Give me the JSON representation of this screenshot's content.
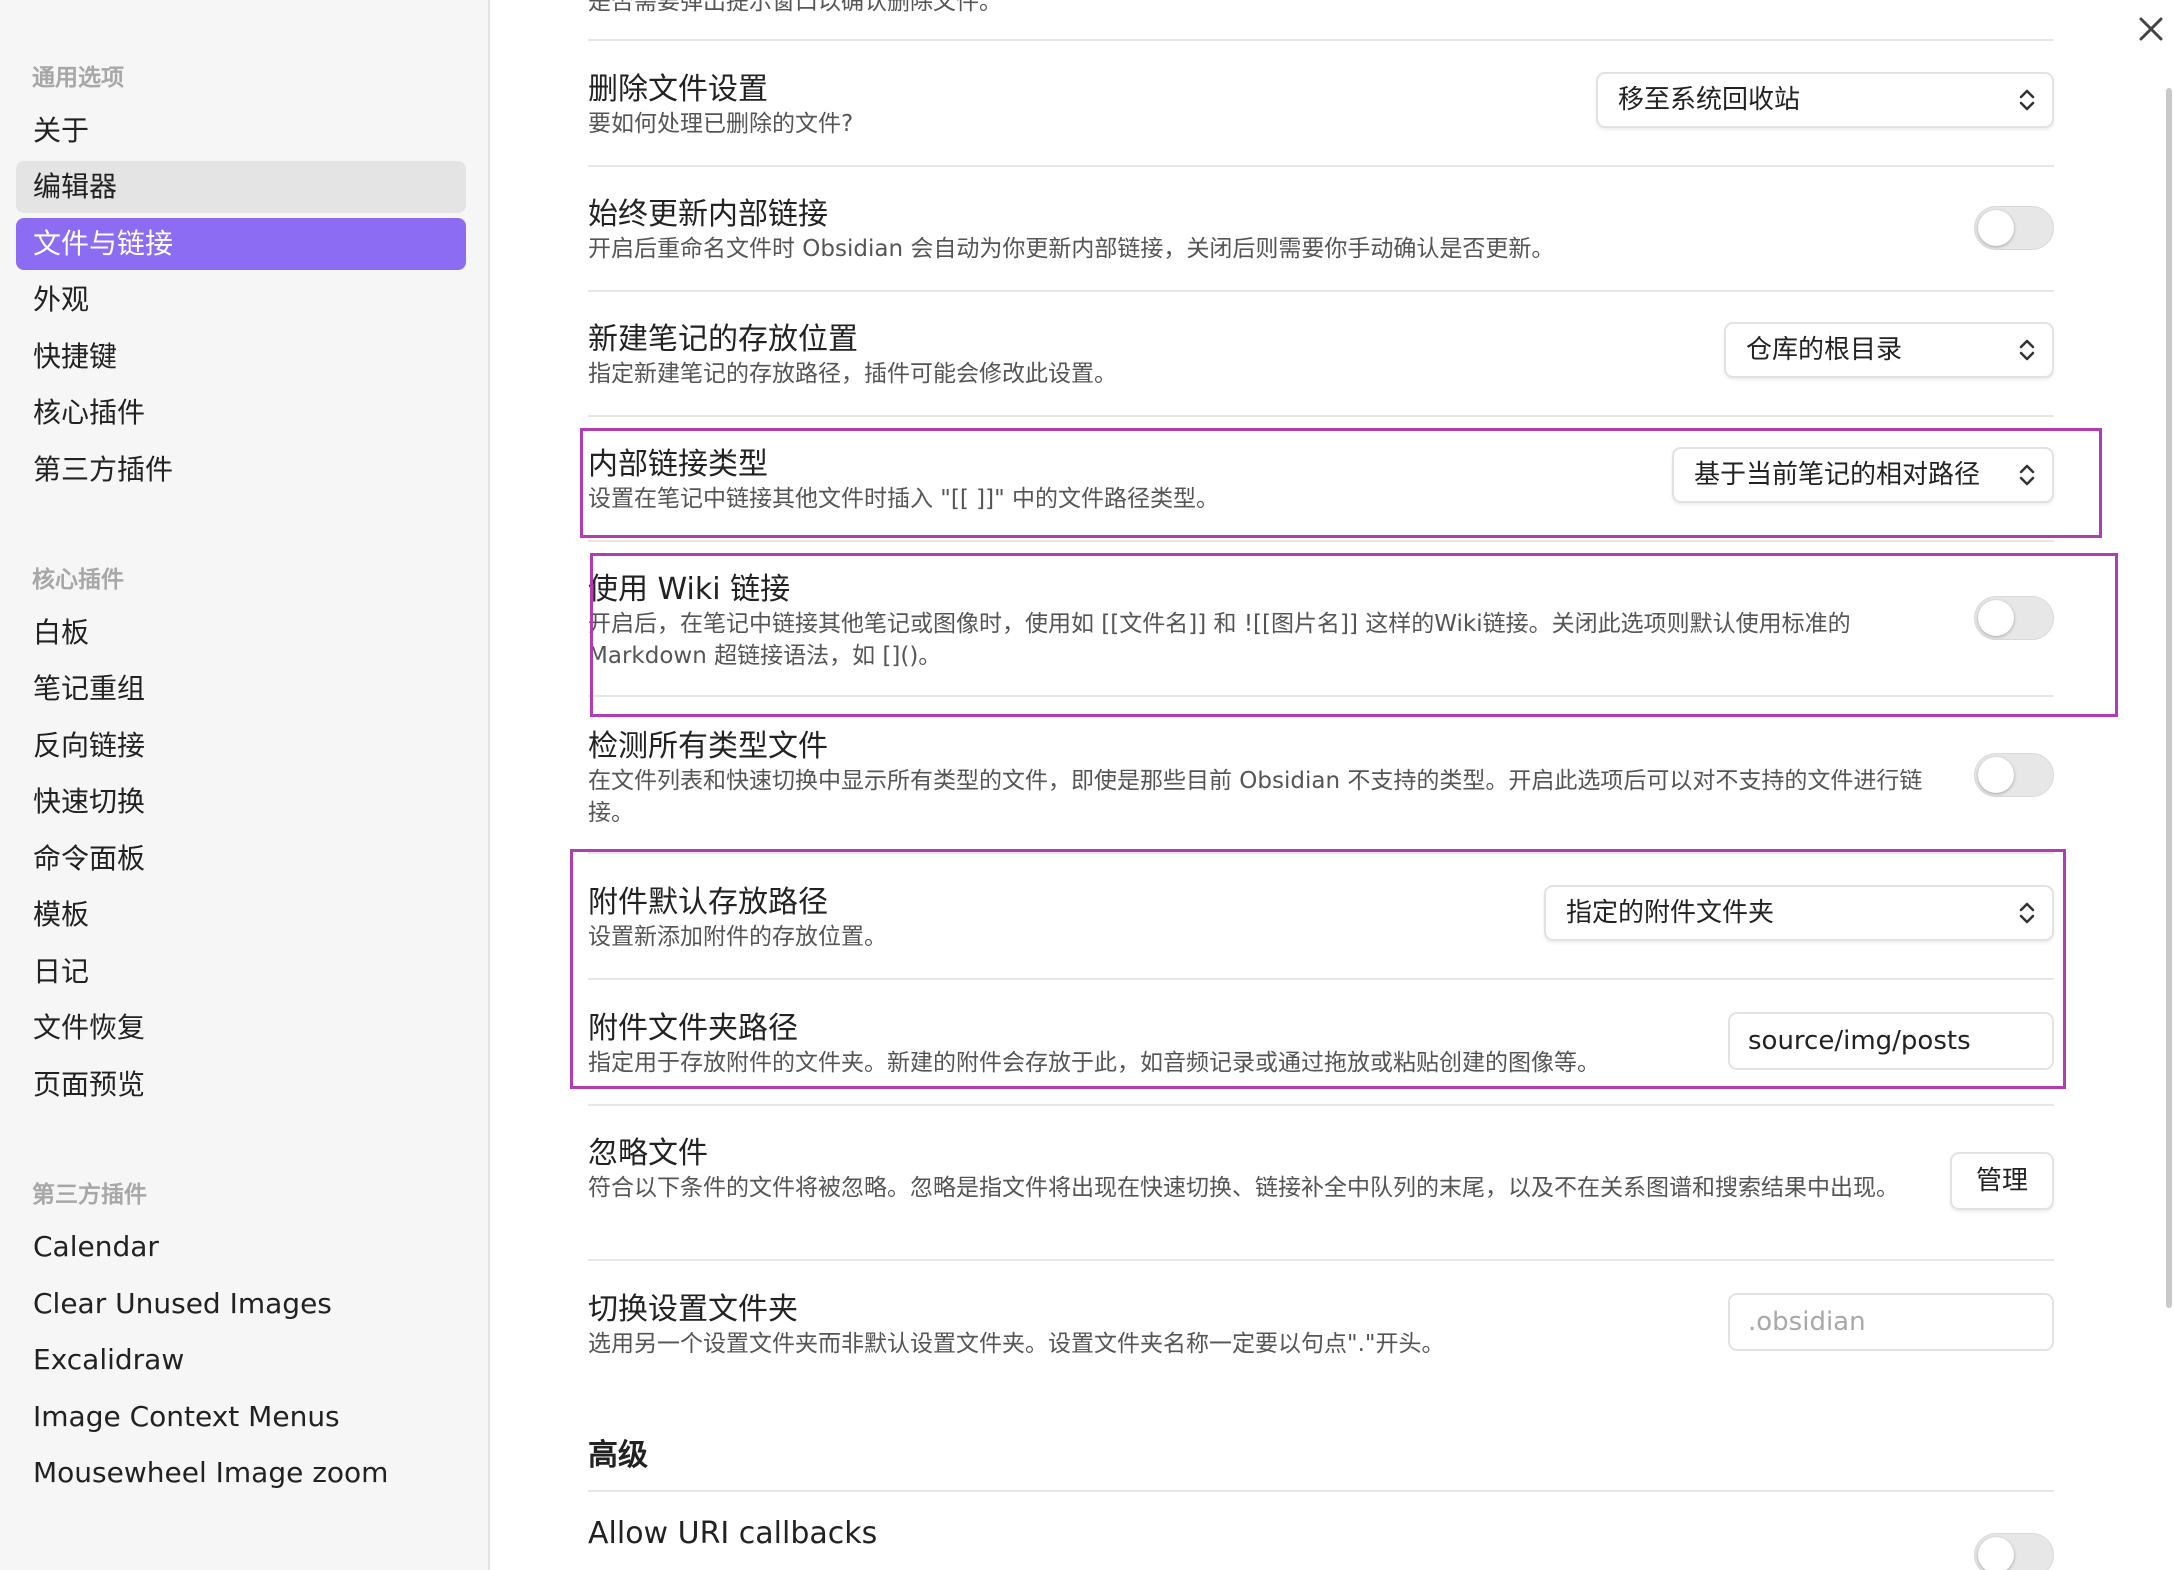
{
  "sidebar": {
    "groups": [
      {
        "title": "通用选项",
        "items": [
          "关于",
          "编辑器",
          "文件与链接",
          "外观",
          "快捷键",
          "核心插件",
          "第三方插件"
        ]
      },
      {
        "title": "核心插件",
        "items": [
          "白板",
          "笔记重组",
          "反向链接",
          "快速切换",
          "命令面板",
          "模板",
          "日记",
          "文件恢复",
          "页面预览"
        ]
      },
      {
        "title": "第三方插件",
        "items": [
          "Calendar",
          "Clear Unused Images",
          "Excalidraw",
          "Image Context Menus",
          "Mousewheel Image zoom"
        ]
      }
    ],
    "active_item": "文件与链接",
    "hover_item": "编辑器"
  },
  "settings": {
    "cut_top_desc": "是否需要弹出提示窗口以确认删除文件。",
    "delete_files": {
      "title": "删除文件设置",
      "desc": "要如何处理已删除的文件?",
      "value": "移至系统回收站"
    },
    "auto_update_links": {
      "title": "始终更新内部链接",
      "desc": "开启后重命名文件时 Obsidian 会自动为你更新内部链接，关闭后则需要你手动确认是否更新。",
      "enabled": false
    },
    "new_note_location": {
      "title": "新建笔记的存放位置",
      "desc": "指定新建笔记的存放路径，插件可能会修改此设置。",
      "value": "仓库的根目录"
    },
    "link_format": {
      "title": "内部链接类型",
      "desc": "设置在笔记中链接其他文件时插入 \"[[ ]]\" 中的文件路径类型。",
      "value": "基于当前笔记的相对路径"
    },
    "wiki_links": {
      "title": "使用 Wiki 链接",
      "desc": "开启后，在笔记中链接其他笔记或图像时，使用如 [[文件名]] 和 ![[图片名]] 这样的Wiki链接。关闭此选项则默认使用标准的 Markdown 超链接语法，如 []()。",
      "enabled": false
    },
    "detect_all_files": {
      "title": "检测所有类型文件",
      "desc": "在文件列表和快速切换中显示所有类型的文件，即使是那些目前 Obsidian 不支持的类型。开启此选项后可以对不支持的文件进行链接。",
      "enabled": false
    },
    "attachment_location": {
      "title": "附件默认存放路径",
      "desc": "设置新添加附件的存放位置。",
      "value": "指定的附件文件夹"
    },
    "attachment_folder": {
      "title": "附件文件夹路径",
      "desc": "指定用于存放附件的文件夹。新建的附件会存放于此，如音频记录或通过拖放或粘贴创建的图像等。",
      "value": "source/img/posts"
    },
    "ignore_files": {
      "title": "忽略文件",
      "desc": "符合以下条件的文件将被忽略。忽略是指文件将出现在快速切换、链接补全中队列的末尾，以及不在关系图谱和搜索结果中出现。",
      "button": "管理"
    },
    "config_folder": {
      "title": "切换设置文件夹",
      "desc": "选用另一个设置文件夹而非默认设置文件夹。设置文件夹名称一定要以句点\".\"开头。",
      "placeholder": ".obsidian"
    },
    "advanced_heading": "高级",
    "uri_callbacks": {
      "title": "Allow URI callbacks",
      "enabled": false
    }
  },
  "colors": {
    "accent": "#8b6cf2",
    "annotation": "#b23cb3"
  },
  "icons": {
    "close": "close-icon",
    "select": "chevron-up-down-icon"
  }
}
